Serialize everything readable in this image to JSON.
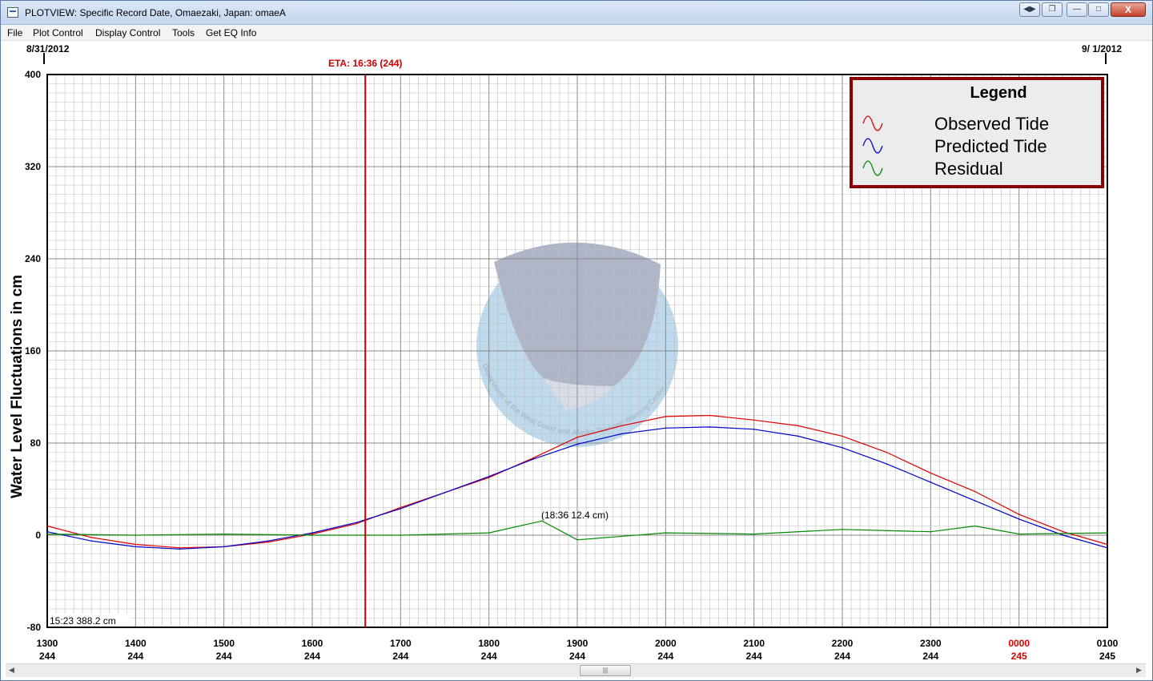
{
  "window": {
    "title": "PLOTVIEW: Specific Record Date, Omaezaki, Japan: omaeA",
    "buttons": {
      "minimize": "—",
      "maximize": "□",
      "close": "X"
    }
  },
  "menu": [
    "File",
    "Plot Control",
    "Display Control",
    "Tools",
    "Get EQ Info"
  ],
  "plot": {
    "date_start": "8/31/2012",
    "date_end": "9/ 1/2012",
    "eta_label": "ETA: 16:36 (244)",
    "eta_x": 1636,
    "ylabel": "Water Level Fluctuations in cm",
    "cursor_readout": "15:23 388.2 cm",
    "peak_annotation": "(18:36  12.4 cm)",
    "legend": {
      "title": "Legend",
      "items": [
        {
          "label": "Observed Tide",
          "color": "#dd0000"
        },
        {
          "label": "Predicted Tide",
          "color": "#0000cc"
        },
        {
          "label": "Residual",
          "color": "#008800"
        }
      ]
    },
    "watermark_text": "Department of the West Coast and Alaska Tsunami Warning Center"
  },
  "chart_data": {
    "type": "line",
    "ylim": [
      -80,
      400
    ],
    "yticks": [
      400,
      320,
      240,
      160,
      80,
      0,
      -80
    ],
    "xticks": [
      {
        "hour": "1300",
        "day": "244",
        "red": false
      },
      {
        "hour": "1400",
        "day": "244",
        "red": false
      },
      {
        "hour": "1500",
        "day": "244",
        "red": false
      },
      {
        "hour": "1600",
        "day": "244",
        "red": false
      },
      {
        "hour": "1700",
        "day": "244",
        "red": false
      },
      {
        "hour": "1800",
        "day": "244",
        "red": false
      },
      {
        "hour": "1900",
        "day": "244",
        "red": false
      },
      {
        "hour": "2000",
        "day": "244",
        "red": false
      },
      {
        "hour": "2100",
        "day": "244",
        "red": false
      },
      {
        "hour": "2200",
        "day": "244",
        "red": false
      },
      {
        "hour": "2300",
        "day": "244",
        "red": false
      },
      {
        "hour": "0000",
        "day": "245",
        "red": true
      },
      {
        "hour": "0100",
        "day": "245",
        "red": false
      }
    ],
    "grid": true,
    "series": [
      {
        "name": "Observed Tide",
        "color": "#dd0000",
        "x": [
          "13:00",
          "13:30",
          "14:00",
          "14:30",
          "15:00",
          "15:30",
          "16:00",
          "16:30",
          "17:00",
          "17:30",
          "18:00",
          "18:30",
          "19:00",
          "19:30",
          "20:00",
          "20:30",
          "21:00",
          "21:30",
          "22:00",
          "22:30",
          "23:00",
          "23:30",
          "00:00",
          "00:30",
          "01:00"
        ],
        "y": [
          8,
          -2,
          -8,
          -11,
          -10,
          -6,
          1,
          10,
          24,
          37,
          50,
          67,
          85,
          95,
          103,
          104,
          100,
          95,
          86,
          72,
          54,
          38,
          18,
          3,
          -8
        ]
      },
      {
        "name": "Predicted Tide",
        "color": "#0000cc",
        "x": [
          "13:00",
          "13:30",
          "14:00",
          "14:30",
          "15:00",
          "15:30",
          "16:00",
          "16:30",
          "17:00",
          "17:30",
          "18:00",
          "18:30",
          "19:00",
          "19:30",
          "20:00",
          "20:30",
          "21:00",
          "21:30",
          "22:00",
          "22:30",
          "23:00",
          "23:30",
          "00:00",
          "00:30",
          "01:00"
        ],
        "y": [
          3,
          -5,
          -10,
          -12,
          -10,
          -5,
          2,
          11,
          23,
          37,
          51,
          66,
          79,
          88,
          93,
          94,
          92,
          86,
          76,
          62,
          46,
          30,
          14,
          0,
          -11
        ]
      },
      {
        "name": "Residual",
        "color": "#008800",
        "x": [
          "13:00",
          "14:00",
          "15:00",
          "16:00",
          "17:00",
          "18:00",
          "18:36",
          "19:00",
          "20:00",
          "21:00",
          "22:00",
          "23:00",
          "23:30",
          "00:00",
          "01:00"
        ],
        "y": [
          1,
          0,
          1,
          0,
          0,
          2,
          12.4,
          -4,
          2,
          1,
          5,
          3,
          8,
          1,
          2
        ]
      }
    ]
  }
}
